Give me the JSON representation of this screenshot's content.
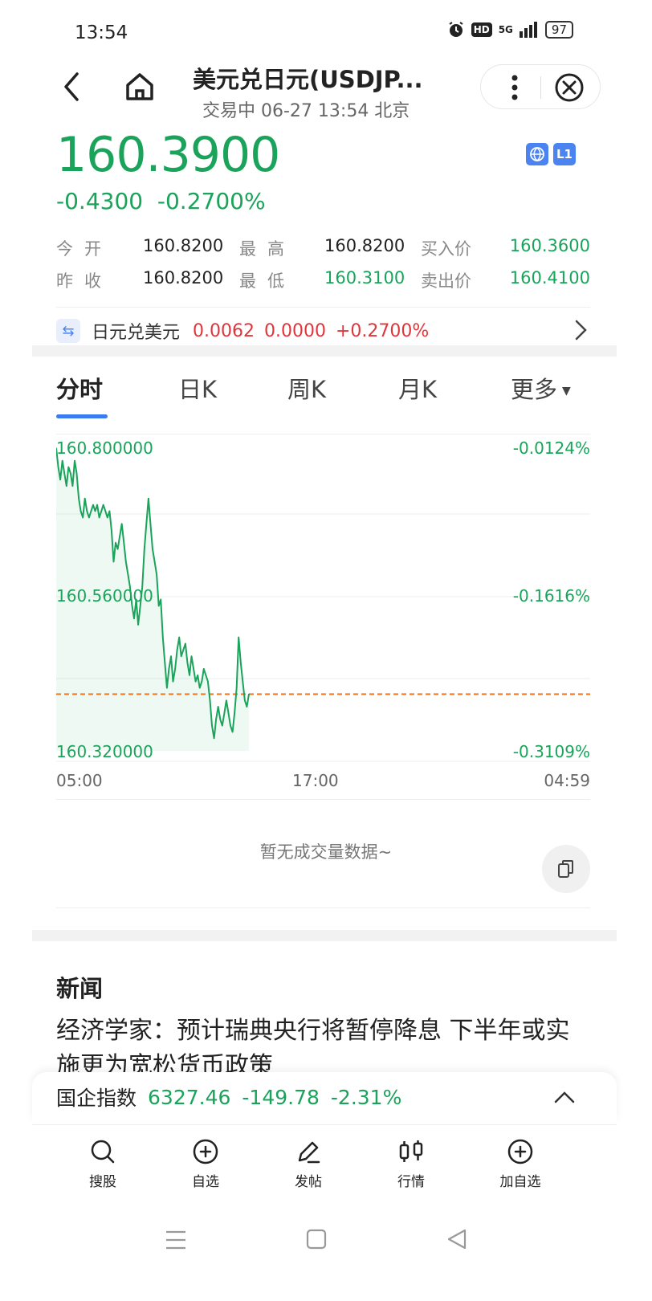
{
  "status_bar": {
    "time": "13:54",
    "network": "HD",
    "signal": "5G",
    "battery": "97"
  },
  "header": {
    "title": "美元兑日元(USDJP...",
    "subtitle": "交易中 06-27 13:54 北京"
  },
  "quote": {
    "price": "160.3900",
    "change": "-0.4300",
    "change_pct": "-0.2700%",
    "badge_l1": "L1",
    "open_label": "今开",
    "open": "160.8200",
    "high_label": "最高",
    "high": "160.8200",
    "bid_label": "买入价",
    "bid": "160.3600",
    "prev_close_label": "昨收",
    "prev_close": "160.8200",
    "low_label": "最低",
    "low": "160.3100",
    "ask_label": "卖出价",
    "ask": "160.4100"
  },
  "cross_rate": {
    "name": "日元兑美元",
    "price": "0.0062",
    "change": "0.0000",
    "change_pct": "+0.2700%"
  },
  "tabs": [
    {
      "label": "分时"
    },
    {
      "label": "日K"
    },
    {
      "label": "周K"
    },
    {
      "label": "月K"
    },
    {
      "label": "更多"
    }
  ],
  "chart_data": {
    "type": "line",
    "title": "",
    "y_left_ticks": [
      "160.800000",
      "160.560000",
      "160.320000"
    ],
    "y_right_ticks": [
      "-0.0124%",
      "-0.1616%",
      "-0.3109%"
    ],
    "x_ticks": [
      "05:00",
      "17:00",
      "04:59"
    ],
    "ylim": [
      160.32,
      160.8
    ],
    "prev_close": 160.41,
    "series": [
      {
        "values": [
          160.8,
          160.77,
          160.75,
          160.78,
          160.76,
          160.74,
          160.77,
          160.76,
          160.74,
          160.78,
          160.76,
          160.72,
          160.7,
          160.69,
          160.72,
          160.7,
          160.69,
          160.7,
          160.71,
          160.7,
          160.71,
          160.69,
          160.7,
          160.71,
          160.7,
          160.69,
          160.7,
          160.67,
          160.62,
          160.65,
          160.64,
          160.66,
          160.68,
          160.65,
          160.62,
          160.6,
          160.58,
          160.55,
          160.53,
          160.56,
          160.52,
          160.55,
          160.58,
          160.64,
          160.68,
          160.72,
          160.68,
          160.64,
          160.62,
          160.6,
          160.55,
          160.56,
          160.5,
          160.46,
          160.42,
          160.45,
          160.47,
          160.43,
          160.45,
          160.48,
          160.5,
          160.47,
          160.48,
          160.49,
          160.46,
          160.44,
          160.47,
          160.45,
          160.43,
          160.44,
          160.42,
          160.43,
          160.45,
          160.44,
          160.43,
          160.4,
          160.36,
          160.34,
          160.37,
          160.39,
          160.37,
          160.36,
          160.38,
          160.4,
          160.38,
          160.36,
          160.35,
          160.38,
          160.42,
          160.5,
          160.46,
          160.43,
          160.4,
          160.39,
          160.41
        ]
      }
    ]
  },
  "volume": {
    "empty_text": "暂无成交量数据~"
  },
  "news": {
    "section_title": "新闻",
    "headline": "经济学家：预计瑞典央行将暂停降息 下半年或实施更为宽松货币政策"
  },
  "ticker": {
    "name": "国企指数",
    "value": "6327.46",
    "change": "-149.78",
    "change_pct": "-2.31%"
  },
  "bottom_nav": [
    {
      "label": "搜股",
      "icon": "search-icon"
    },
    {
      "label": "自选",
      "icon": "add-watchlist-icon"
    },
    {
      "label": "发帖",
      "icon": "pen-icon"
    },
    {
      "label": "行情",
      "icon": "candlestick-icon"
    },
    {
      "label": "加自选",
      "icon": "add-circle-icon"
    }
  ],
  "colors": {
    "up_down_green": "#1aa35a",
    "red": "#e0353b",
    "accent_blue": "#3a7bf2",
    "prev_close_line": "#f07b27"
  }
}
